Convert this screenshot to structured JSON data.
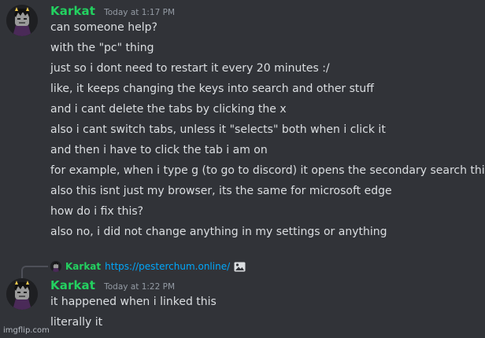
{
  "message1": {
    "username": "Karkat",
    "timestamp": "Today at 1:17 PM",
    "lines": [
      "can someone help?",
      "with the \"pc\" thing",
      "just so i dont need to restart it every 20 minutes :/",
      "like, it keeps changing the keys into search and other stuff",
      "and i cant delete the tabs by clicking the x",
      "also i cant switch tabs, unless it \"selects\" both when i click it",
      "and then i have to click the tab i am on",
      "for example, when i type g (to go to discord) it opens the secondary search thing",
      "also this isnt just my browser, its the same for microsoft edge",
      "how do i fix this?",
      "also no, i did not change anything in my settings or anything"
    ]
  },
  "reply": {
    "username": "Karkat",
    "link": "https://pesterchum.online/",
    "icon": "image-icon"
  },
  "message2": {
    "username": "Karkat",
    "timestamp": "Today at 1:22 PM",
    "lines": [
      "it happened when i linked this",
      "literally it"
    ]
  },
  "watermark": "imgflip.com",
  "colors": {
    "background": "#313338",
    "username": "#23d160",
    "link": "#00a8fc",
    "text": "#dbdee1",
    "timestamp": "#949ba4"
  }
}
